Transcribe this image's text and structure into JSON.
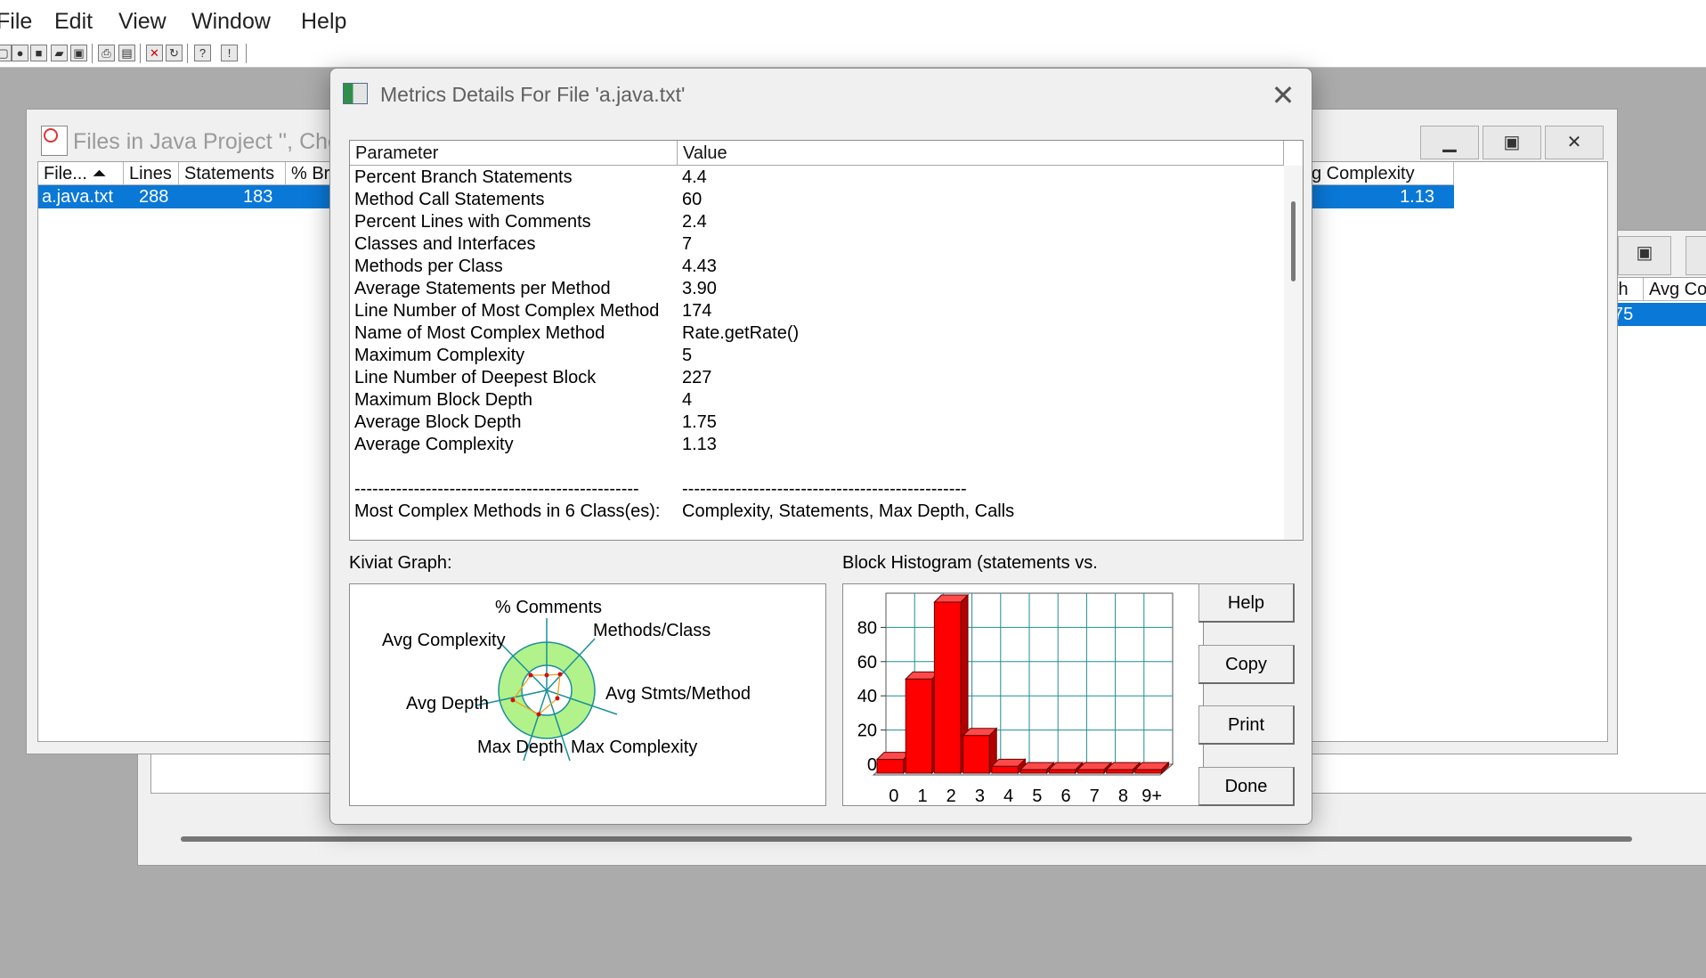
{
  "menu": [
    "File",
    "Edit",
    "View",
    "Window",
    "Help"
  ],
  "toolbar_icons": [
    "new-icon",
    "open-icon",
    "save-icon",
    "open-folder-icon",
    "disk-icon",
    "print-icon",
    "print-preview-icon",
    "delete-icon",
    "refresh-icon",
    "whats-this-icon",
    "info-icon"
  ],
  "files_window": {
    "title": "Files in Java Project '', Che",
    "columns": [
      "File...",
      "Lines",
      "Statements",
      "% Br",
      "g Complexity"
    ],
    "row": {
      "file": "a.java.txt",
      "lines": "288",
      "statements": "183",
      "avg_complexity": "1.13"
    }
  },
  "third_window": {
    "columns": [
      "th",
      "Avg Co"
    ],
    "row_value": "75"
  },
  "dialog": {
    "title": "Metrics Details For File 'a.java.txt'",
    "close_glyph": "✕",
    "columns": {
      "parameter": "Parameter",
      "value": "Value"
    },
    "rows": [
      {
        "param": "Percent Branch Statements",
        "value": "4.4"
      },
      {
        "param": "Method Call Statements",
        "value": "60"
      },
      {
        "param": "Percent Lines with Comments",
        "value": "2.4"
      },
      {
        "param": "Classes and Interfaces",
        "value": "7"
      },
      {
        "param": "Methods per Class",
        "value": "4.43"
      },
      {
        "param": "Average Statements per Method",
        "value": "3.90"
      },
      {
        "param": "Line Number of Most Complex Method",
        "value": "174"
      },
      {
        "param": "Name of Most Complex Method",
        "value": "Rate.getRate()"
      },
      {
        "param": "Maximum Complexity",
        "value": "5"
      },
      {
        "param": "Line Number of Deepest Block",
        "value": "227"
      },
      {
        "param": "Maximum Block Depth",
        "value": "4"
      },
      {
        "param": "Average Block Depth",
        "value": "1.75"
      },
      {
        "param": "Average Complexity",
        "value": "1.13"
      },
      {
        "param": "",
        "value": ""
      },
      {
        "param": "------------------------------------------------",
        "value": "------------------------------------------------"
      },
      {
        "param": "Most Complex Methods in 6 Class(es):",
        "value": "Complexity, Statements, Max Depth, Calls"
      }
    ],
    "kiviat_label": "Kiviat Graph:",
    "histogram_label": "Block Histogram (statements vs.",
    "kiviat_axes": [
      "% Comments",
      "Methods/Class",
      "Avg Stmts/Method",
      "Max Complexity",
      "Max Depth",
      "Avg Depth",
      "Avg Complexity"
    ],
    "buttons": {
      "help": "Help",
      "copy": "Copy",
      "print": "Print",
      "done": "Done"
    }
  },
  "chart_data": {
    "type": "bar",
    "categories": [
      "0",
      "1",
      "2",
      "3",
      "4",
      "5",
      "6",
      "7",
      "8",
      "9+"
    ],
    "values": [
      8,
      55,
      100,
      22,
      4,
      2,
      2,
      2,
      2,
      2
    ],
    "yticks": [
      "0",
      "20",
      "40",
      "60",
      "80"
    ],
    "ylim": [
      0,
      100
    ],
    "bar_color": "#ff0000",
    "grid_color": "#1f8f8f"
  }
}
